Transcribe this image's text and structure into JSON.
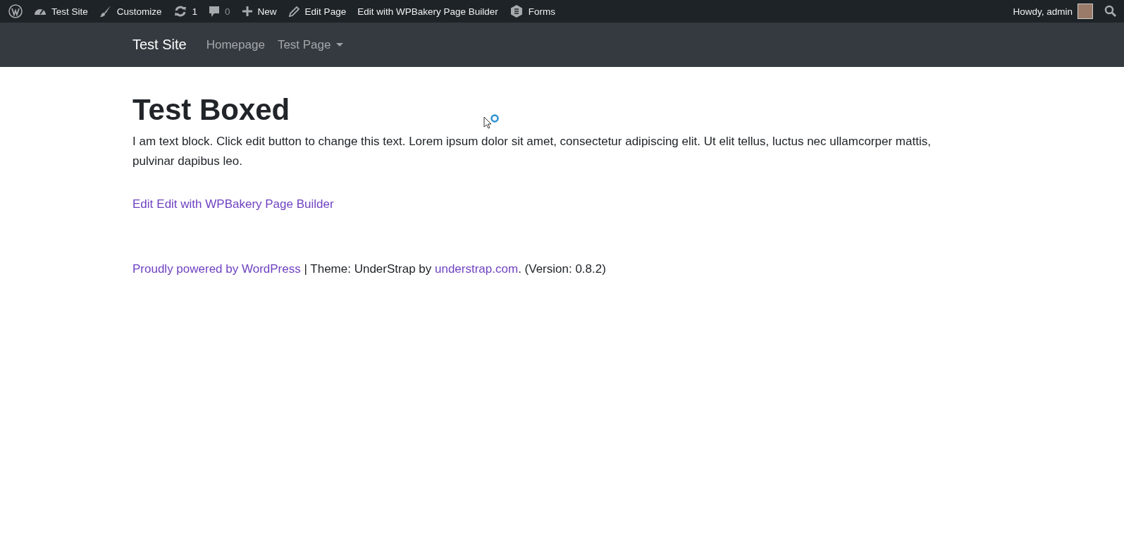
{
  "admin_bar": {
    "items": [
      {
        "kind": "wordpress"
      },
      {
        "kind": "dashboard",
        "label": "Test Site"
      },
      {
        "kind": "brush",
        "label": "Customize"
      },
      {
        "kind": "updates",
        "label": "1"
      },
      {
        "kind": "comments",
        "label": "0"
      },
      {
        "kind": "new",
        "label": "New"
      },
      {
        "kind": "edit",
        "label": "Edit Page"
      },
      {
        "kind": "plain",
        "label": "Edit with WPBakery Page Builder"
      },
      {
        "kind": "forms",
        "label": "Forms"
      }
    ],
    "greeting": "Howdy, admin"
  },
  "navbar": {
    "brand": "Test Site",
    "items": [
      {
        "label": "Homepage",
        "selected": false,
        "dropdown": false
      },
      {
        "label": "Test Page",
        "selected": false,
        "dropdown": true
      }
    ]
  },
  "page": {
    "title": "Test Boxed",
    "text": "I am text block. Click edit button to change this text. Lorem ipsum dolor sit amet, consectetur adipiscing elit. Ut elit tellus, luctus nec ullamcorper mattis, pulvinar dapibus leo.",
    "edit_links": [
      "Edit",
      "Edit with WPBakery Page Builder"
    ]
  },
  "footer": {
    "parts": [
      {
        "kind": "link",
        "text": "Proudly powered by WordPress"
      },
      {
        "kind": "text",
        "text": " | Theme: UnderStrap by "
      },
      {
        "kind": "link",
        "text": "understrap.com"
      },
      {
        "kind": "text",
        "text": ". (Version: 0.8.2)"
      }
    ]
  }
}
